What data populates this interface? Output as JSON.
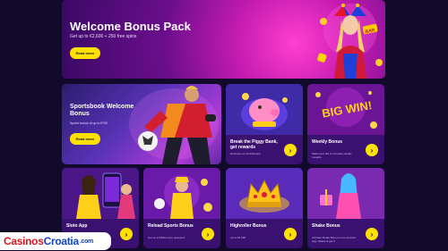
{
  "hero": {
    "title": "Welcome Bonus Pack",
    "subtitle": "Get up to €2,600 + 250 free spins",
    "button": "Read more",
    "sign": "BAR"
  },
  "sportsbook": {
    "title": "Sportsbook Welcome Bonus",
    "subtitle": "Sports bonus of up to €700",
    "button": "Read more"
  },
  "cards": {
    "piggy": {
      "title": "Break the Piggy Bank, get rewards",
      "desc": "Exclusive on Android app",
      "arrow": "›"
    },
    "weekly": {
      "title": "Weekly Bonus",
      "desc": "Make your 3rd to increase weekly rewards",
      "arrow": "›",
      "art_text": "BIG WIN!"
    },
    "sloto": {
      "title": "Sloto App",
      "desc": "",
      "arrow": "›"
    },
    "reload": {
      "title": "Reload Sports Bonus",
      "desc": "Get up to €100 every weekend",
      "arrow": "›"
    },
    "high": {
      "title": "Highroller Bonus",
      "desc": "Up to €2,000",
      "arrow": "›"
    },
    "shake": {
      "title": "Shake Bonus",
      "desc": "Activate Shake Bonus in our Android App. Shake & get it",
      "arrow": "›"
    }
  },
  "logo": {
    "part1": "Casinos",
    "part2": "Croatia",
    "part3": ".com"
  },
  "colors": {
    "accent": "#ffe100",
    "background": "#120a2a",
    "card": "#3a1070"
  }
}
